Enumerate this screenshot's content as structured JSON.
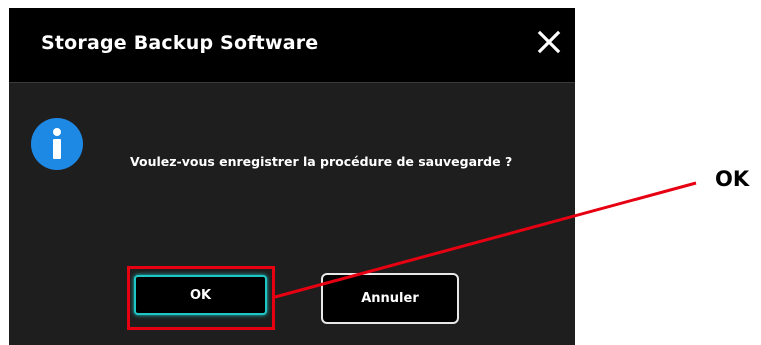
{
  "dialog": {
    "title": "Storage Backup Software",
    "message": "Voulez-vous enregistrer la procédure de sauvegarde ?",
    "icons": {
      "close": "close-icon",
      "info": "info-icon"
    },
    "buttons": {
      "ok_label": "OK",
      "cancel_label": "Annuler"
    }
  },
  "annotation": {
    "label": "OK",
    "color": "#e60012"
  },
  "colors": {
    "dialog_background": "#1e1e1e",
    "titlebar_background": "#000000",
    "info_icon": "#1e88e5",
    "ok_focus": "#1fc6c6"
  }
}
